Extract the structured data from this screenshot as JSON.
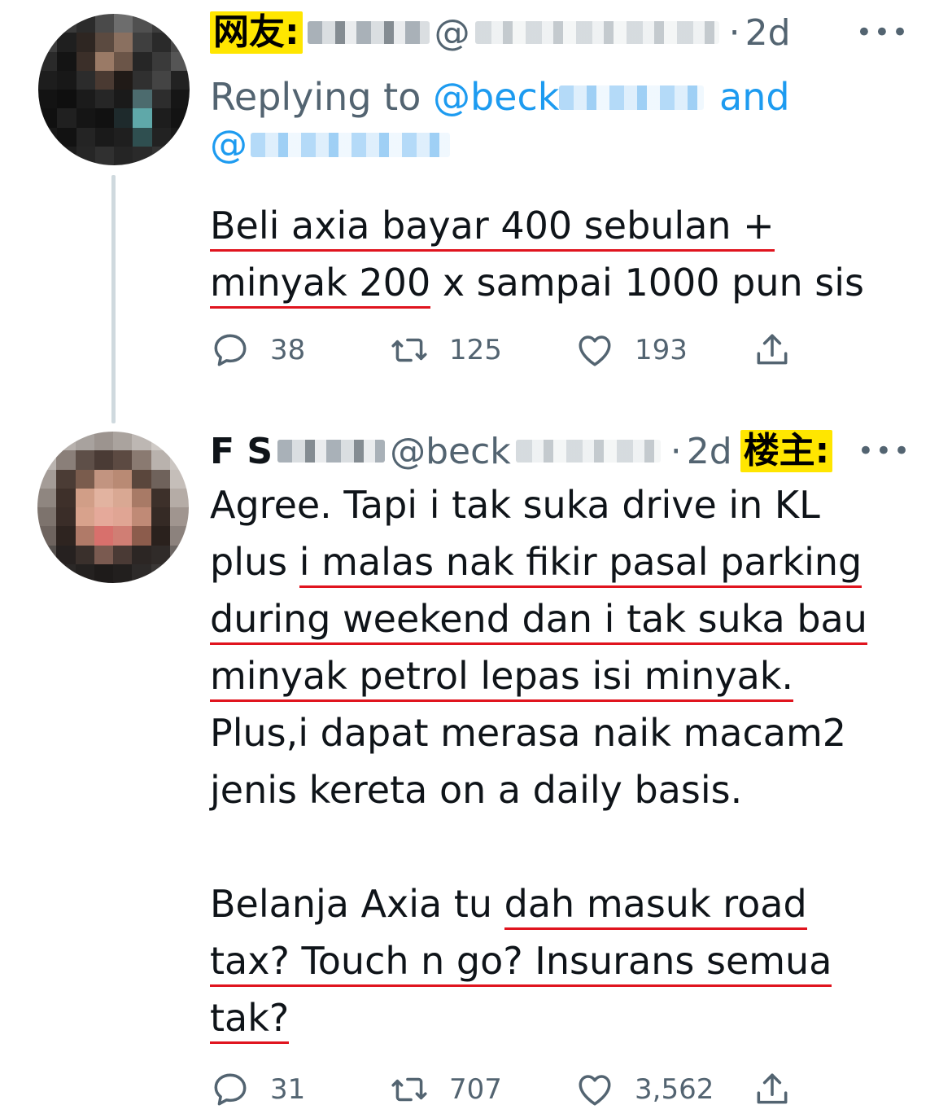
{
  "tweet1": {
    "label": "网友:",
    "handle_prefix": "@",
    "time": "2d",
    "replying_label": "Replying to",
    "mention1": "@beck",
    "and_label": "and",
    "mention2": "@",
    "lines": [
      "Beli axia bayar 400 sebulan +",
      "minyak 200",
      " x sampai 1000 pun sis"
    ],
    "stats": {
      "replies": "38",
      "retweets": "125",
      "likes": "193"
    }
  },
  "tweet2": {
    "name": "F S",
    "handle": "@beck",
    "time": "2d",
    "label": "楼主:",
    "p1": {
      "l1": "Agree. Tapi i tak suka drive in KL",
      "l2a": "plus ",
      "l2b": "i malas nak fikir pasal parking",
      "l3": "during weekend dan i tak suka bau",
      "l4": "minyak petrol lepas isi minyak.",
      "l5": "Plus,i dapat merasa naik macam2",
      "l6": "jenis kereta on a daily basis."
    },
    "p2": {
      "l1a": "Belanja Axia tu ",
      "l1b": "dah masuk road",
      "l2": "tax? Touch n go? Insurans semua",
      "l3": "tak?"
    },
    "stats": {
      "replies": "31",
      "retweets": "707",
      "likes": "3,562"
    }
  },
  "icons": {
    "reply": "reply-icon",
    "retweet": "retweet-icon",
    "like": "heart-icon",
    "share": "share-icon",
    "more": "more-icon"
  },
  "colors": {
    "link": "#1d9bf0",
    "muted": "#536471",
    "underline": "#e0141e",
    "label_bg": "#ffe600"
  }
}
